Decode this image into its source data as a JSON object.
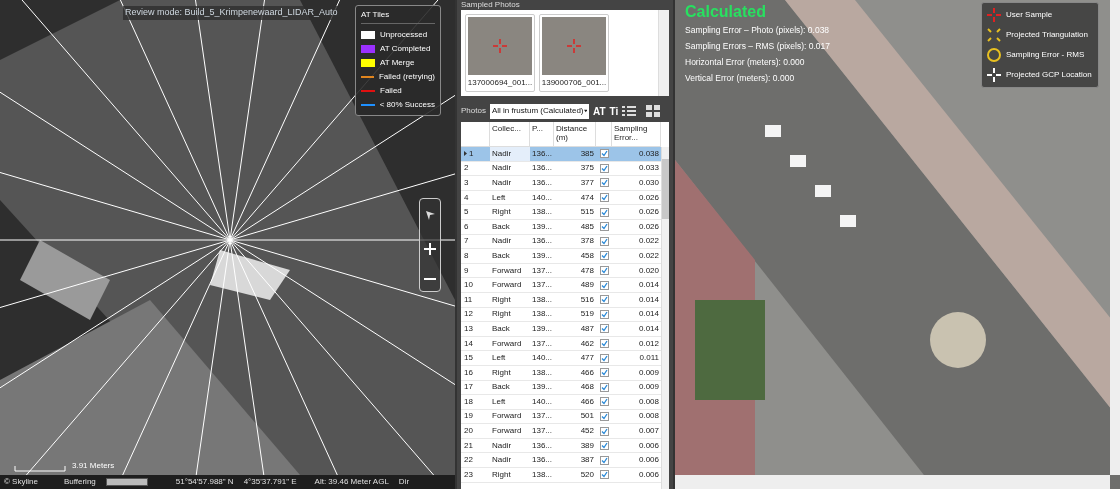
{
  "viewer": {
    "title": "Review mode: Build_5_Krimpenewaard_LIDAR_Auto",
    "legend": {
      "title": "AT Tiles",
      "items": [
        {
          "label": "Unprocessed",
          "kind": "swatch",
          "color": "#ffffff"
        },
        {
          "label": "AT Completed",
          "kind": "swatch",
          "color": "#9b30ff"
        },
        {
          "label": "AT Merge",
          "kind": "swatch",
          "color": "#ffff00"
        },
        {
          "label": "Failed (retrying)",
          "kind": "line",
          "color": "#e0851e"
        },
        {
          "label": "Failed",
          "kind": "line",
          "color": "#e01010"
        },
        {
          "label": "< 80% Success",
          "kind": "line",
          "color": "#1e90ff"
        }
      ]
    },
    "scale": "3.91 Meters"
  },
  "status_bar": {
    "brand": "© Skyline",
    "buffering": "Buffering",
    "level": 1,
    "latitude": "51°54'57.988\" N",
    "longitude": "4°35'37.791\" E",
    "altitude": "Alt: 39.46 Meter AGL",
    "direction": "Dir"
  },
  "photos_panel": {
    "title": "Sampled Photos",
    "thumbnails": [
      "137000694_001...",
      "139000706_001..."
    ],
    "filter_label": "Photos",
    "filter_value": "All in frustum (Calculated)",
    "toolbar": [
      "AT",
      "Ti"
    ]
  },
  "table": {
    "columns": [
      "Collec...",
      "P...",
      "Distance (m)",
      "",
      "Sampling Error..."
    ],
    "rows": [
      {
        "num": "1",
        "dir": "Nadir",
        "p": "136...",
        "dist": "385",
        "checked": true,
        "err": "0.038",
        "selected": true
      },
      {
        "num": "2",
        "dir": "Nadir",
        "p": "136...",
        "dist": "375",
        "checked": true,
        "err": "0.033",
        "selected": false
      },
      {
        "num": "3",
        "dir": "Nadir",
        "p": "136...",
        "dist": "377",
        "checked": true,
        "err": "0.030",
        "selected": false
      },
      {
        "num": "4",
        "dir": "Left",
        "p": "140...",
        "dist": "474",
        "checked": true,
        "err": "0.026",
        "selected": false
      },
      {
        "num": "5",
        "dir": "Right",
        "p": "138...",
        "dist": "515",
        "checked": true,
        "err": "0.026",
        "selected": false
      },
      {
        "num": "6",
        "dir": "Back",
        "p": "139...",
        "dist": "485",
        "checked": true,
        "err": "0.026",
        "selected": false
      },
      {
        "num": "7",
        "dir": "Nadir",
        "p": "136...",
        "dist": "378",
        "checked": true,
        "err": "0.022",
        "selected": false
      },
      {
        "num": "8",
        "dir": "Back",
        "p": "139...",
        "dist": "458",
        "checked": true,
        "err": "0.022",
        "selected": false
      },
      {
        "num": "9",
        "dir": "Forward",
        "p": "137...",
        "dist": "478",
        "checked": true,
        "err": "0.020",
        "selected": false
      },
      {
        "num": "10",
        "dir": "Forward",
        "p": "137...",
        "dist": "489",
        "checked": true,
        "err": "0.014",
        "selected": false
      },
      {
        "num": "11",
        "dir": "Right",
        "p": "138...",
        "dist": "516",
        "checked": true,
        "err": "0.014",
        "selected": false
      },
      {
        "num": "12",
        "dir": "Right",
        "p": "138...",
        "dist": "519",
        "checked": true,
        "err": "0.014",
        "selected": false
      },
      {
        "num": "13",
        "dir": "Back",
        "p": "139...",
        "dist": "487",
        "checked": true,
        "err": "0.014",
        "selected": false
      },
      {
        "num": "14",
        "dir": "Forward",
        "p": "137...",
        "dist": "462",
        "checked": true,
        "err": "0.012",
        "selected": false
      },
      {
        "num": "15",
        "dir": "Left",
        "p": "140...",
        "dist": "477",
        "checked": true,
        "err": "0.011",
        "selected": false
      },
      {
        "num": "16",
        "dir": "Right",
        "p": "138...",
        "dist": "466",
        "checked": true,
        "err": "0.009",
        "selected": false
      },
      {
        "num": "17",
        "dir": "Back",
        "p": "139...",
        "dist": "468",
        "checked": true,
        "err": "0.009",
        "selected": false
      },
      {
        "num": "18",
        "dir": "Left",
        "p": "140...",
        "dist": "466",
        "checked": true,
        "err": "0.008",
        "selected": false
      },
      {
        "num": "19",
        "dir": "Forward",
        "p": "137...",
        "dist": "501",
        "checked": true,
        "err": "0.008",
        "selected": false
      },
      {
        "num": "20",
        "dir": "Forward",
        "p": "137...",
        "dist": "452",
        "checked": true,
        "err": "0.007",
        "selected": false
      },
      {
        "num": "21",
        "dir": "Nadir",
        "p": "136...",
        "dist": "389",
        "checked": true,
        "err": "0.006",
        "selected": false
      },
      {
        "num": "22",
        "dir": "Nadir",
        "p": "136...",
        "dist": "387",
        "checked": true,
        "err": "0.006",
        "selected": false
      },
      {
        "num": "23",
        "dir": "Right",
        "p": "138...",
        "dist": "520",
        "checked": true,
        "err": "0.006",
        "selected": false
      }
    ]
  },
  "map": {
    "status": "Calculated",
    "metrics": [
      "Sampling Error – Photo (pixels): 0.038",
      "Sampling Errors – RMS (pixels): 0.017",
      "Horizontal Error (meters): 0.000",
      "Vertical Error (meters): 0.000"
    ],
    "legend": [
      {
        "label": "User Sample",
        "kind": "user"
      },
      {
        "label": "Projected Triangulation",
        "kind": "triangulation"
      },
      {
        "label": "Sampling Error - RMS",
        "kind": "rms"
      },
      {
        "label": "Projected GCP Location",
        "kind": "gcp"
      }
    ]
  }
}
